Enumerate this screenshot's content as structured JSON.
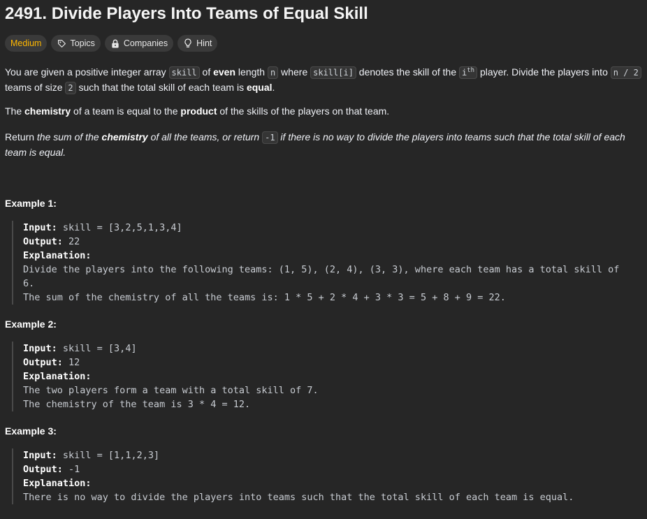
{
  "problem": {
    "title": "2491. Divide Players Into Teams of Equal Skill",
    "tags": {
      "difficulty": "Medium",
      "topics": "Topics",
      "companies": "Companies",
      "hint": "Hint"
    },
    "icons": {
      "topics": "tag-icon",
      "companies": "lock-icon",
      "hint": "lightbulb-icon"
    },
    "colors": {
      "background": "#262626",
      "difficulty_medium": "#ffb800"
    },
    "description": {
      "p1": {
        "t1": "You are given a positive integer array ",
        "c1": "skill",
        "t2": " of ",
        "b1": "even",
        "t3": " length ",
        "c2": "n",
        "t4": " where ",
        "c3": "skill[i]",
        "t5": " denotes the skill of the ",
        "c4_base": "i",
        "c4_sup": "th",
        "t6": " player. Divide the players into ",
        "c5": "n / 2",
        "t7": " teams of size ",
        "c6": "2",
        "t8": " such that the total skill of each team is ",
        "b2": "equal",
        "t9": "."
      },
      "p2": {
        "t1": "The ",
        "b1": "chemistry",
        "t2": " of a team is equal to the ",
        "b2": "product",
        "t3": " of the skills of the players on that team."
      },
      "p3": {
        "t1": "Return ",
        "i1": "the sum of the ",
        "b1": "chemistry",
        "i2": " of all the teams, or return ",
        "c1": "-1",
        "i3": " if there is no way to divide the players into teams such that the total skill of each team is equal."
      }
    },
    "examples": [
      {
        "title": "Example 1:",
        "input_label": "Input:",
        "input": " skill = [3,2,5,1,3,4]",
        "output_label": "Output:",
        "output": " 22",
        "explanation_label": "Explanation:",
        "explanation": [
          "Divide the players into the following teams: (1, 5), (2, 4), (3, 3), where each team has a total skill of",
          "6.",
          "The sum of the chemistry of all the teams is: 1 * 5 + 2 * 4 + 3 * 3 = 5 + 8 + 9 = 22."
        ]
      },
      {
        "title": "Example 2:",
        "input_label": "Input:",
        "input": " skill = [3,4]",
        "output_label": "Output:",
        "output": " 12",
        "explanation_label": "Explanation:",
        "explanation": [
          "The two players form a team with a total skill of 7.",
          "The chemistry of the team is 3 * 4 = 12."
        ]
      },
      {
        "title": "Example 3:",
        "input_label": "Input:",
        "input": " skill = [1,1,2,3]",
        "output_label": "Output:",
        "output": " -1",
        "explanation_label": "Explanation:",
        "explanation": [
          "There is no way to divide the players into teams such that the total skill of each team is equal."
        ]
      }
    ]
  }
}
